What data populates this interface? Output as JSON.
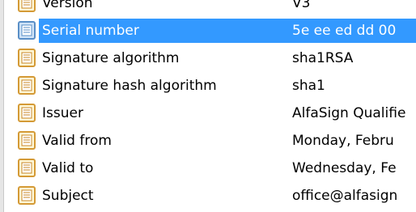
{
  "colors": {
    "selection": "#3399ff",
    "icon_fill": "#fff7d6",
    "icon_border": "#d49a36",
    "icon_lines": "#c98a2a",
    "icon_selected_fill": "#cfe3f7",
    "icon_selected_border": "#5a8fc7"
  },
  "details": {
    "rows": [
      {
        "field": "Version",
        "value": "V3",
        "icon": "certificate-field-icon"
      },
      {
        "field": "Serial number",
        "value": "5e ee ed dd 00",
        "icon": "certificate-field-icon",
        "selected": true
      },
      {
        "field": "Signature algorithm",
        "value": "sha1RSA",
        "icon": "certificate-field-icon"
      },
      {
        "field": "Signature hash algorithm",
        "value": "sha1",
        "icon": "certificate-field-icon"
      },
      {
        "field": "Issuer",
        "value": "AlfaSign Qualifie",
        "icon": "certificate-field-icon"
      },
      {
        "field": "Valid from",
        "value": "Monday, Febru",
        "icon": "certificate-field-icon"
      },
      {
        "field": "Valid to",
        "value": "Wednesday, Fe",
        "icon": "certificate-field-icon"
      },
      {
        "field": "Subject",
        "value": "office@alfasign",
        "icon": "certificate-field-icon"
      }
    ]
  }
}
